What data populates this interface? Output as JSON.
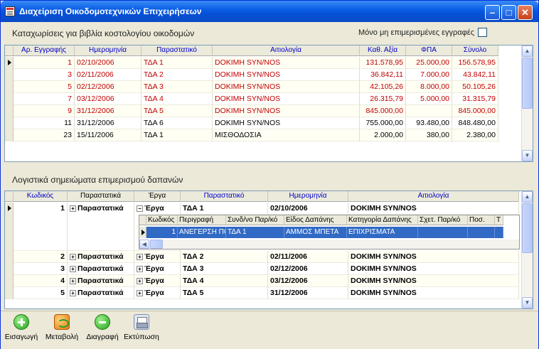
{
  "window": {
    "title": "Διαχείριση Οικοδομοτεχνικών Επιχειρήσεων"
  },
  "top_panel": {
    "title": "Καταχωρίσεις για βιβλία κοστολογίου οικοδομών",
    "checkbox_label": "Μόνο μη επιμερισμένες εγγραφές",
    "checkbox_checked": false,
    "columns": [
      "Αρ. Εγγραφής",
      "Ημερομηνία",
      "Παραστατικό",
      "Αιτιολογία",
      "Καθ. Αξία",
      "ΦΠΑ",
      "Σύνολο"
    ],
    "rows": [
      {
        "no": "1",
        "date": "02/10/2006",
        "doc": "ΤΔΑ 1",
        "reason": "DOKIMH SYN/NOS",
        "net": "131.578,95",
        "vat": "25.000,00",
        "total": "156.578,95",
        "red": true,
        "current": true
      },
      {
        "no": "3",
        "date": "02/11/2006",
        "doc": "ΤΔΑ 2",
        "reason": "DOKIMH SYN/NOS",
        "net": "36.842,11",
        "vat": "7.000,00",
        "total": "43.842,11",
        "red": true
      },
      {
        "no": "5",
        "date": "02/12/2006",
        "doc": "ΤΔΑ 3",
        "reason": "DOKIMH SYN/NOS",
        "net": "42.105,26",
        "vat": "8.000,00",
        "total": "50.105,26",
        "red": true
      },
      {
        "no": "7",
        "date": "03/12/2006",
        "doc": "ΤΔΑ 4",
        "reason": "DOKIMH SYN/NOS",
        "net": "26.315,79",
        "vat": "5.000,00",
        "total": "31.315,79",
        "red": true
      },
      {
        "no": "9",
        "date": "31/12/2006",
        "doc": "ΤΔΑ 5",
        "reason": "DOKIMH SYN/NOS",
        "net": "845.000,00",
        "vat": "",
        "total": "845.000,00",
        "red": true
      },
      {
        "no": "11",
        "date": "31/12/2006",
        "doc": "ΤΔΑ 6",
        "reason": "DOKIMH SYN/NOS",
        "net": "755.000,00",
        "vat": "93.480,00",
        "total": "848.480,00",
        "red": false
      },
      {
        "no": "23",
        "date": "15/11/2006",
        "doc": "ΤΔΑ 1",
        "reason": "ΜΙΣΘΟΔΟΣΙΑ",
        "net": "2.000,00",
        "vat": "380,00",
        "total": "2.380,00",
        "red": false
      }
    ]
  },
  "bottom_panel": {
    "title": "Λογιστικά σημειώματα επιμερισμού δαπανών",
    "columns": [
      "Κωδικός",
      "Παραστατικά",
      "Έργα",
      "Παραστατικό",
      "Ημερομηνία",
      "Αιτιολογία"
    ],
    "rows": [
      {
        "code": "1",
        "docs": "Παραστατικά",
        "works": "Έργα",
        "doc": "ΤΔΑ 1",
        "date": "02/10/2006",
        "reason": "DOKIMH SYN/NOS",
        "expanded": true,
        "current": true
      },
      {
        "code": "2",
        "docs": "Παραστατικά",
        "works": "Έργα",
        "doc": "ΤΔΑ 2",
        "date": "02/11/2006",
        "reason": "DOKIMH SYN/NOS"
      },
      {
        "code": "3",
        "docs": "Παραστατικά",
        "works": "Έργα",
        "doc": "ΤΔΑ 3",
        "date": "02/12/2006",
        "reason": "DOKIMH SYN/NOS"
      },
      {
        "code": "4",
        "docs": "Παραστατικά",
        "works": "Έργα",
        "doc": "ΤΔΑ 4",
        "date": "03/12/2006",
        "reason": "DOKIMH SYN/NOS"
      },
      {
        "code": "5",
        "docs": "Παραστατικά",
        "works": "Έργα",
        "doc": "ΤΔΑ 5",
        "date": "31/12/2006",
        "reason": "DOKIMH SYN/NOS"
      }
    ],
    "sub_grid": {
      "columns": [
        "Κωδικός",
        "Περιγραφή",
        "Συνδ/νο Παρ/κό",
        "Είδος Δαπάνης",
        "Κατηγορία Δαπάνης",
        "Σχετ. Παρ/κό",
        "Ποσ.",
        "Τ"
      ],
      "row": {
        "code": "1",
        "desc": "ΑΝΕΓΕΡΣΗ ΠΟΛΥΚΑ",
        "linked": "ΤΔΑ 1",
        "type": "ΑΜΜΟΣ ΜΠΕΤΑ",
        "category": "ΕΠΙΧΡΙΣΜΑΤΑ",
        "rel": "",
        "qty": "",
        "t": ""
      }
    }
  },
  "toolbar": {
    "buttons": [
      {
        "label": "Εισαγωγή",
        "icon": "add-icon"
      },
      {
        "label": "Μεταβολή",
        "icon": "edit-icon"
      },
      {
        "label": "Διαγραφή",
        "icon": "delete-icon"
      },
      {
        "label": "Εκτύπωση",
        "icon": "print-icon"
      }
    ]
  },
  "colors": {
    "title_bar": "#0a5fe6",
    "selection": "#316ac5",
    "header_text": "#0000c8",
    "red_row_text": "#c00000"
  }
}
